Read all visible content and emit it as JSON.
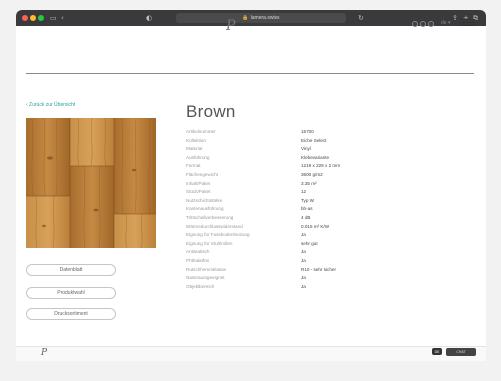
{
  "browser": {
    "url": "lamera.swiss",
    "controls": [
      "sidebar-icon",
      "back-icon",
      "shield-icon",
      "share-icon",
      "add-tab-icon",
      "tabs-icon"
    ]
  },
  "header": {
    "logo": "P",
    "social": [
      "f",
      "i",
      "in"
    ],
    "language": "de"
  },
  "left": {
    "back_link": "‹ Zurück zur Übersicht",
    "buttons": [
      "Datenblatt",
      "Produktwahl",
      "Drucksortiment"
    ]
  },
  "product": {
    "title": "Brown",
    "specs": [
      {
        "label": "Artikelnummer",
        "value": "15700"
      },
      {
        "label": "Kollektion",
        "value": "Eiche Select"
      },
      {
        "label": "Material",
        "value": "Vinyl"
      },
      {
        "label": "Ausführung",
        "value": "Klebevariante"
      },
      {
        "label": "Format",
        "value": "1219 x 229 x 2 mm"
      },
      {
        "label": "Flächengewicht",
        "value": "3600 g/m2"
      },
      {
        "label": "Inhalt/Paket",
        "value": "3.35 m²"
      },
      {
        "label": "Stück/Paket",
        "value": "12"
      },
      {
        "label": "Nutzschichtstärke",
        "value": "Typ W"
      },
      {
        "label": "Kantenausführung",
        "value": "bh-as"
      },
      {
        "label": "Trittschallverbesserung",
        "value": "4 dB"
      },
      {
        "label": "Wärmedurchlasswiderstand",
        "value": "0.015 m² K/W"
      },
      {
        "label": "Eignung für Fussbodenheizung",
        "value": "Ja"
      },
      {
        "label": "Eignung für Stuhlrollen",
        "value": "sehr gut"
      },
      {
        "label": "Antistatisch",
        "value": "Ja"
      },
      {
        "label": "Phthalatfrei",
        "value": "Ja"
      },
      {
        "label": "Rutschhemmklasse",
        "value": "R10 - sehr sicher"
      },
      {
        "label": "Nassraumgeeignet",
        "value": "Ja"
      },
      {
        "label": "Objektbereich",
        "value": "Ja"
      }
    ]
  },
  "footer": {
    "logo": "P",
    "badge": "DE",
    "widget": "CHAT"
  },
  "colors": {
    "accent": "#2aa39a",
    "wood_base": "#b47a35",
    "wood_dark": "#8d5a22",
    "wood_light": "#d7a15a"
  }
}
